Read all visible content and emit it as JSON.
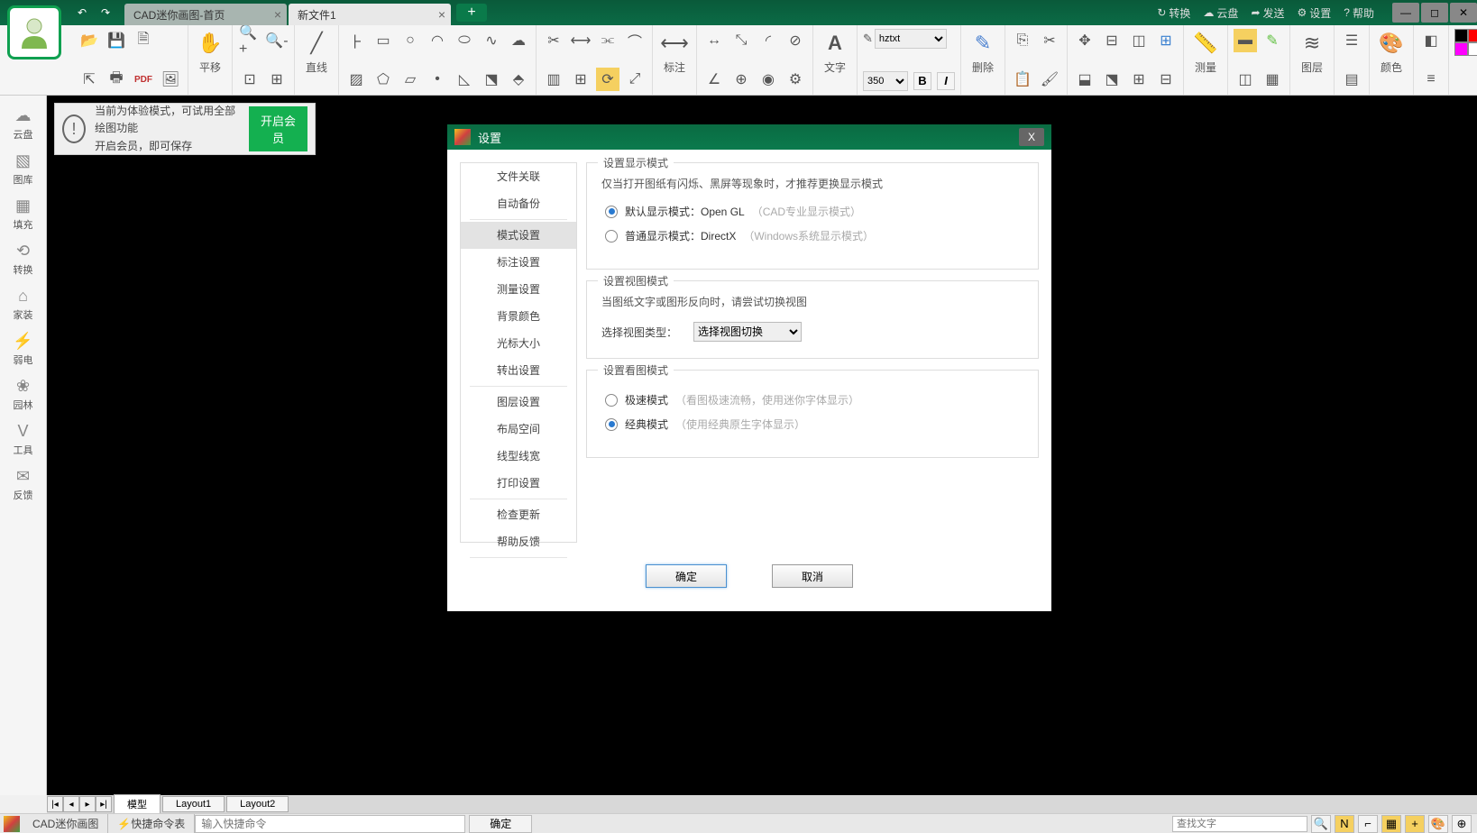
{
  "titlebar": {
    "tabs": [
      {
        "label": "CAD迷你画图-首页",
        "active": false
      },
      {
        "label": "新文件1",
        "active": true
      }
    ],
    "right": [
      {
        "icon": "↻",
        "label": "转换"
      },
      {
        "icon": "☁",
        "label": "云盘"
      },
      {
        "icon": "➦",
        "label": "发送"
      },
      {
        "icon": "⚙",
        "label": "设置"
      },
      {
        "icon": "?",
        "label": "帮助"
      }
    ]
  },
  "ribbon": {
    "translate": "平移",
    "line": "直线",
    "annot": "标注",
    "text": "文字",
    "font": "hztxt",
    "size": "350",
    "delete": "删除",
    "measure": "测量",
    "layer": "图层",
    "color": "颜色",
    "colors": [
      "#000000",
      "#ff0000",
      "#ffff00",
      "#00ff00",
      "#00ffff",
      "#0000ff",
      "#ff00ff",
      "#ffffff",
      "#808080",
      "#c0c0c0",
      "#800000",
      "#008000"
    ]
  },
  "sidebar": [
    {
      "icon": "☁",
      "label": "云盘"
    },
    {
      "icon": "▧",
      "label": "图库"
    },
    {
      "icon": "▦",
      "label": "填充"
    },
    {
      "icon": "⟲",
      "label": "转换"
    },
    {
      "icon": "⌂",
      "label": "家装"
    },
    {
      "icon": "⚡",
      "label": "弱电"
    },
    {
      "icon": "❀",
      "label": "园林"
    },
    {
      "icon": "V",
      "label": "工具"
    },
    {
      "icon": "✉",
      "label": "反馈"
    }
  ],
  "trial": {
    "line1": "当前为体验模式，可试用全部绘图功能",
    "line2": "开启会员，即可保存",
    "button": "开启会员"
  },
  "dialog": {
    "title": "设置",
    "nav": [
      "文件关联",
      "自动备份",
      "模式设置",
      "标注设置",
      "测量设置",
      "背景颜色",
      "光标大小",
      "转出设置",
      "图层设置",
      "布局空间",
      "线型线宽",
      "打印设置",
      "检查更新",
      "帮助反馈"
    ],
    "nav_active": 2,
    "section1": {
      "legend": "设置显示模式",
      "desc": "仅当打开图纸有闪烁、黑屏等现象时，才推荐更换显示模式",
      "opt1_label": "默认显示模式：Open GL",
      "opt1_hint": "（CAD专业显示模式）",
      "opt2_label": "普通显示模式：DirectX",
      "opt2_hint": "（Windows系统显示模式）"
    },
    "section2": {
      "legend": "设置视图模式",
      "desc": "当图纸文字或图形反向时，请尝试切换视图",
      "sel_label": "选择视图类型：",
      "sel_value": "选择视图切换"
    },
    "section3": {
      "legend": "设置看图模式",
      "opt1_label": "极速模式",
      "opt1_hint": "（看图极速流畅，使用迷你字体显示）",
      "opt2_label": "经典模式",
      "opt2_hint": "（使用经典原生字体显示）"
    },
    "ok": "确定",
    "cancel": "取消"
  },
  "bottomtabs": {
    "model": "模型",
    "l1": "Layout1",
    "l2": "Layout2"
  },
  "status": {
    "appname": "CAD迷你画图",
    "cmdtable": "快捷命令表",
    "cmd_placeholder": "输入快捷命令",
    "ok": "确定",
    "search_placeholder": "查找文字"
  }
}
